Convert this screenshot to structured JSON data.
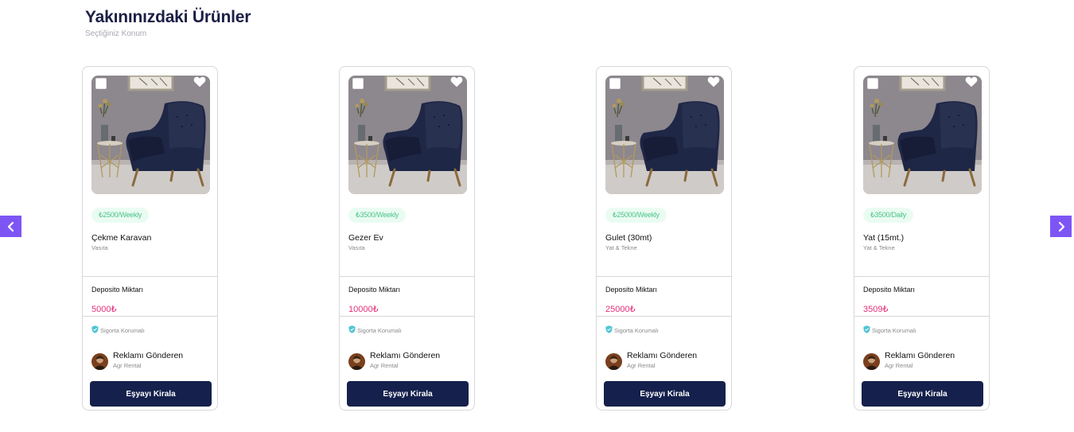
{
  "section": {
    "title": "Yakınınızdaki Ürünler",
    "subtitle": "Seçtiğiniz Konum"
  },
  "colors": {
    "accent": "#7e55f5",
    "primary_button": "#15204c",
    "price_text": "#4cc38a",
    "price_bg": "#eafcf2",
    "deposit_value": "#e5307a",
    "shield": "#4fc3d6"
  },
  "carousel": {
    "prev_icon": "chevron-left-icon",
    "next_icon": "chevron-right-icon"
  },
  "products": [
    {
      "price": "₺2500/Weekly",
      "name": "Çekme Karavan",
      "category": "Vasıta",
      "deposit_label": "Deposito Miktarı",
      "deposit_value": "5000₺",
      "insurance": "Sigorta Korumalı",
      "sender_label": "Reklamı Gönderen",
      "sender_name": "Agr Rental",
      "button": "Eşyayı Kirala"
    },
    {
      "price": "₺3500/Weekly",
      "name": "Gezer Ev",
      "category": "Vasıta",
      "deposit_label": "Deposito Miktarı",
      "deposit_value": "10000₺",
      "insurance": "Sigorta Korumalı",
      "sender_label": "Reklamı Gönderen",
      "sender_name": "Agr Rental",
      "button": "Eşyayı Kirala"
    },
    {
      "price": "₺25000/Weekly",
      "name": "Gulet (30mt)",
      "category": "Yat & Tekne",
      "deposit_label": "Deposito Miktarı",
      "deposit_value": "25000₺",
      "insurance": "Sigorta Korumalı",
      "sender_label": "Reklamı Gönderen",
      "sender_name": "Agr Rental",
      "button": "Eşyayı Kirala"
    },
    {
      "price": "₺3500/Daily",
      "name": "Yat (15mt.)",
      "category": "Yat & Tekne",
      "deposit_label": "Deposito Miktarı",
      "deposit_value": "3509₺",
      "insurance": "Sigorta Korumalı",
      "sender_label": "Reklamı Gönderen",
      "sender_name": "Agr Rental",
      "button": "Eşyayı Kirala"
    }
  ]
}
